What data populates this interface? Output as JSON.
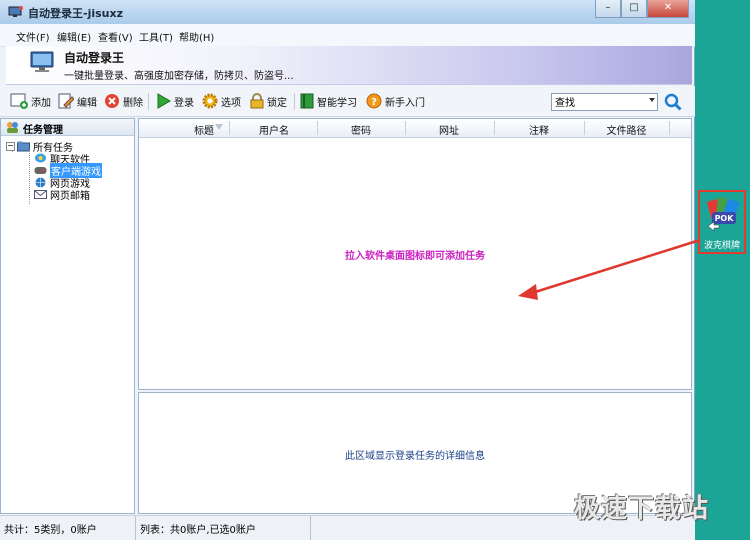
{
  "window": {
    "title": "自动登录王-jisuxz"
  },
  "window_controls": {
    "minimize": "–",
    "maximize": "□",
    "close": "✕"
  },
  "menu": [
    "文件(F)",
    "编辑(E)",
    "查看(V)",
    "工具(T)",
    "帮助(H)"
  ],
  "banner": {
    "title": "自动登录王",
    "subtitle": "一键批量登录、高强度加密存储，防拷贝、防盗号..."
  },
  "toolbar": {
    "add": "添加",
    "edit": "编辑",
    "delete": "删除",
    "login": "登录",
    "options": "选项",
    "lock": "锁定",
    "smart_learn": "智能学习",
    "getting_started": "新手入门"
  },
  "search": {
    "value": "查找"
  },
  "left_panel": {
    "header": "任务管理",
    "root": "所有任务",
    "children": [
      "聊天软件",
      "客户端游戏",
      "网页游戏",
      "网页邮箱"
    ],
    "selected_index": 1
  },
  "table": {
    "columns": [
      "标题",
      "用户名",
      "密码",
      "网址",
      "注释",
      "文件路径"
    ]
  },
  "hints": {
    "drag": "拉入软件桌面图标即可添加任务",
    "detail": "此区域显示登录任务的详细信息"
  },
  "status": {
    "left": "共计：5类别，0账户",
    "right": "列表：共0账户,已选0账户"
  },
  "desktop_icon": {
    "label": "波克棋牌"
  },
  "watermark": "极速下载站",
  "colors": {
    "desktop": "#1aa597",
    "drag_hint": "#cc1fbf",
    "arrow": "#e0372e",
    "selection": "#3399ff"
  }
}
